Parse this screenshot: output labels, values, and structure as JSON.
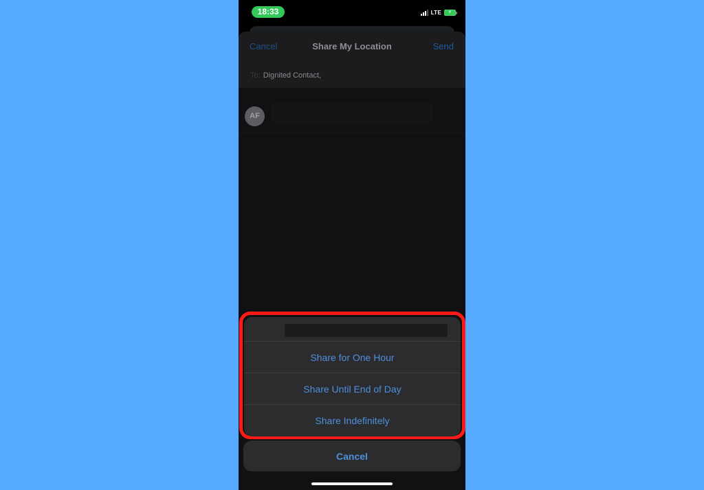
{
  "status_bar": {
    "time": "18:33",
    "network": "LTE",
    "signal_icon": "signal-bars-icon",
    "battery_icon": "battery-charging-icon",
    "time_pill_color": "#34c759"
  },
  "nav": {
    "cancel_label": "Cancel",
    "title": "Share My Location",
    "send_label": "Send"
  },
  "recipient": {
    "label": "To:",
    "value": "Dignited Contact,"
  },
  "message": {
    "avatar_initials": "AF"
  },
  "action_sheet": {
    "items": [
      {
        "label": "Share for One Hour"
      },
      {
        "label": "Share Until End of Day"
      },
      {
        "label": "Share Indefinitely"
      }
    ],
    "cancel_label": "Cancel",
    "accent_color": "#4e8fdc",
    "highlight_color": "#ff1a1a"
  }
}
